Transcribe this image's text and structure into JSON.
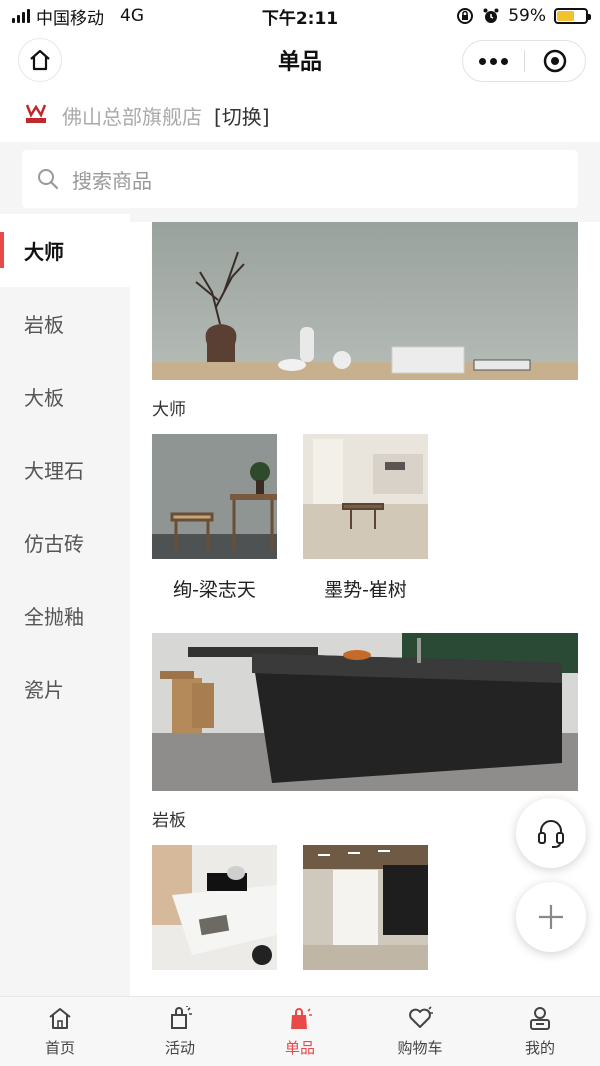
{
  "status_bar": {
    "carrier": "中国移动",
    "network": "4G",
    "time": "下午2:11",
    "battery": "59%",
    "battery_level": 0.59
  },
  "nav": {
    "title": "单品"
  },
  "store": {
    "name": "佛山总部旗舰店",
    "switch_label": "[切换]"
  },
  "search": {
    "placeholder": "搜索商品"
  },
  "categories": [
    {
      "label": "大师",
      "active": true
    },
    {
      "label": "岩板"
    },
    {
      "label": "大板"
    },
    {
      "label": "大理石"
    },
    {
      "label": "仿古砖"
    },
    {
      "label": "全抛釉"
    },
    {
      "label": "瓷片"
    }
  ],
  "sections": [
    {
      "title": "大师",
      "products": [
        {
          "name": "绚-梁志天"
        },
        {
          "name": "墨势-崔树"
        }
      ]
    },
    {
      "title": "岩板",
      "products": [
        {
          "name": ""
        },
        {
          "name": ""
        }
      ]
    }
  ],
  "tabs": [
    {
      "label": "首页",
      "icon": "home-icon"
    },
    {
      "label": "活动",
      "icon": "activity-icon"
    },
    {
      "label": "单品",
      "icon": "shopping-bag-icon",
      "active": true
    },
    {
      "label": "购物车",
      "icon": "heart-cart-icon"
    },
    {
      "label": "我的",
      "icon": "profile-icon"
    }
  ],
  "colors": {
    "accent": "#e84a4a",
    "sidebar_bg": "#f5f5f5",
    "battery": "#f2c12e"
  }
}
